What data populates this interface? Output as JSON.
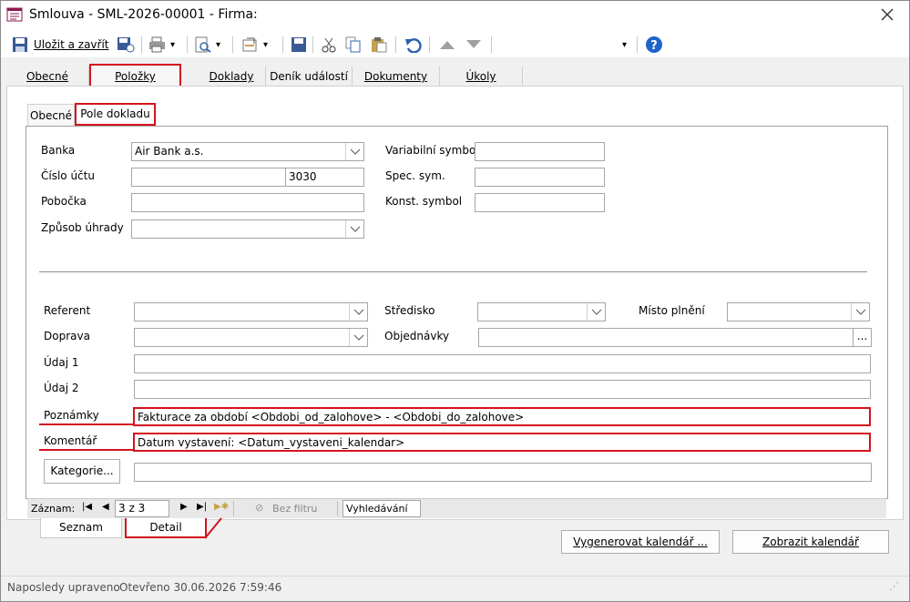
{
  "window": {
    "title": "Smlouva - SML-2026-00001 - Firma:"
  },
  "toolbar": {
    "save_close": "Uložit a zavřít"
  },
  "tabs": [
    "Obecné",
    "Položky",
    "Doklady",
    "Deník událostí",
    "Dokumenty",
    "Úkoly"
  ],
  "subtabs": [
    "Obecné",
    "Pole dokladu"
  ],
  "form": {
    "banka_label": "Banka",
    "banka_value": "Air Bank a.s.",
    "cislo_uctu_label": "Číslo účtu",
    "cislo_uctu_code": "3030",
    "pobocka_label": "Pobočka",
    "zpusob_uhrady_label": "Způsob úhrady",
    "variabilni_label": "Variabilní symbol",
    "spec_sym_label": "Spec. sym.",
    "konst_symbol_label": "Konst. symbol",
    "referent_label": "Referent",
    "stredisko_label": "Středisko",
    "misto_plneni_label": "Místo plnění",
    "doprava_label": "Doprava",
    "objednavky_label": "Objednávky",
    "ellipsis": "...",
    "udaj1_label": "Údaj 1",
    "udaj2_label": "Údaj 2",
    "poznamky_label": "Poznámky",
    "poznamky_value": "Fakturace za období <Obdobi_od_zalohove> - <Obdobi_do_zalohove>",
    "komentar_label": "Komentář",
    "komentar_value": "Datum vystavení: <Datum_vystaveni_kalendar>",
    "kategorie_button": "Kategorie..."
  },
  "record_nav": {
    "label": "Záznam:",
    "position": "3 z 3",
    "filter": "Bez filtru",
    "search_placeholder": "Vyhledávání"
  },
  "bottom_tabs": [
    "Seznam",
    "Detail"
  ],
  "buttons": {
    "generate": "Vygenerovat kalendář ...",
    "show": "Zobrazit kalendář"
  },
  "status": {
    "left": "Naposledy upraveno",
    "opened": "Otevřeno 30.06.2026 7:59:46"
  },
  "colors": {
    "highlight": "#d4141e",
    "accent_blue": "#1e64c8"
  }
}
